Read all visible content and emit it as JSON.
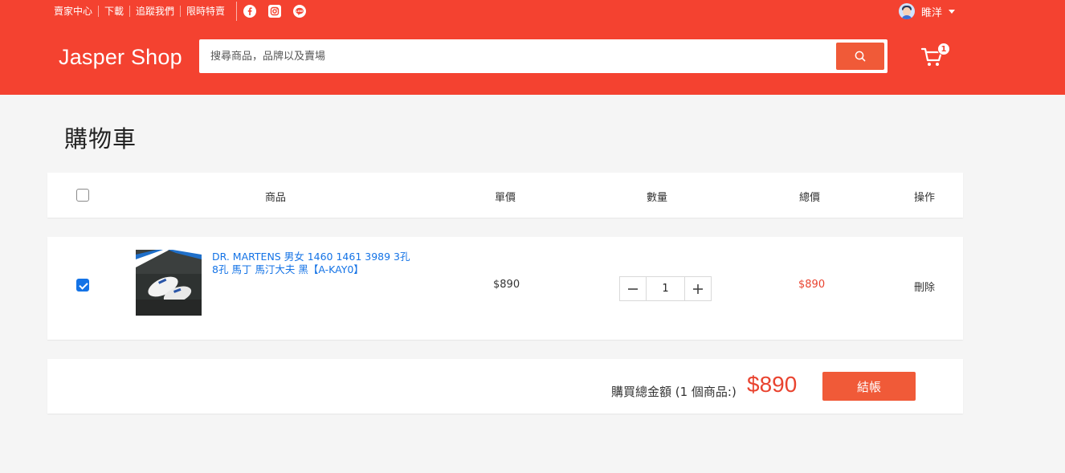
{
  "topbar": {
    "links": [
      "賣家中心",
      "下載",
      "追蹤我們",
      "限時特賣"
    ],
    "social": [
      "facebook-icon",
      "instagram-icon",
      "line-icon"
    ],
    "username": "睢洋"
  },
  "brand": {
    "logo": "Jasper Shop",
    "accent": "#f44230"
  },
  "search": {
    "placeholder": "搜尋商品，品牌以及賣場",
    "value": ""
  },
  "cart": {
    "badge": "1"
  },
  "page": {
    "title": "購物車"
  },
  "table": {
    "headers": {
      "product": "商品",
      "unit_price": "單價",
      "quantity": "數量",
      "total": "總價",
      "action": "操作"
    },
    "items": [
      {
        "selected": true,
        "name": "DR. MARTENS 男女 1460 1461 3989 3孔 8孔 馬丁 馬汀大夫 黑【A-KAY0】",
        "unit_price": "$890",
        "quantity": "1",
        "total": "$890",
        "action": "刪除"
      }
    ]
  },
  "summary": {
    "label": "購買總金額 (1 個商品:)",
    "amount": "$890",
    "checkout": "結帳"
  }
}
